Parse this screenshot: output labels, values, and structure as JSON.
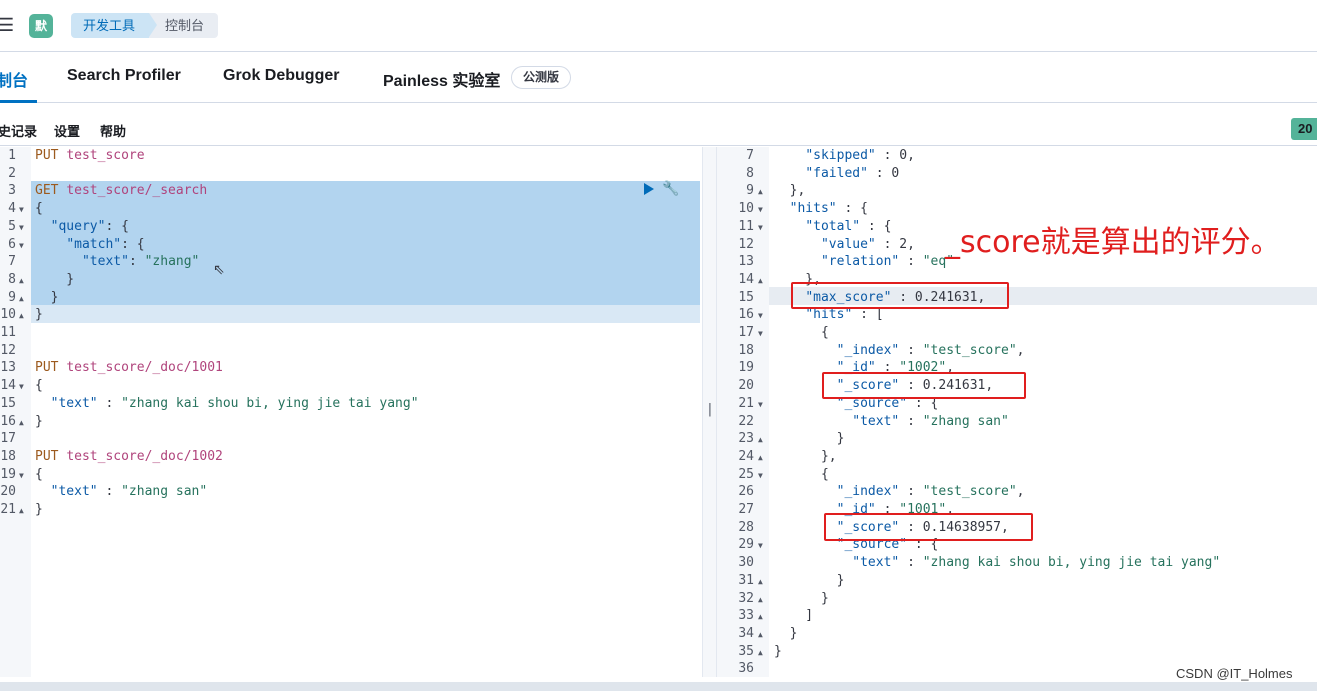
{
  "header": {
    "menu_icon": "hamburger-icon",
    "avatar_letter": "默",
    "breadcrumbs": [
      "开发工具",
      "控制台"
    ]
  },
  "tabs": {
    "console": "制台",
    "search_profiler": "Search Profiler",
    "grok_debugger": "Grok Debugger",
    "painless_lab": "Painless 实验室",
    "beta_badge": "公测版"
  },
  "toolbar": {
    "history": "史记录",
    "settings": "设置",
    "help": "帮助",
    "status_badge": "20"
  },
  "request_editor": {
    "lines": [
      {
        "n": "1",
        "fold": "",
        "text": "PUT test_score"
      },
      {
        "n": "2",
        "fold": "",
        "text": ""
      },
      {
        "n": "3",
        "fold": "",
        "text": "GET test_score/_search"
      },
      {
        "n": "4",
        "fold": "▼",
        "text": "{"
      },
      {
        "n": "5",
        "fold": "▼",
        "text": "  \"query\": {"
      },
      {
        "n": "6",
        "fold": "▼",
        "text": "    \"match\": {"
      },
      {
        "n": "7",
        "fold": "",
        "text": "      \"text\": \"zhang\""
      },
      {
        "n": "8",
        "fold": "▲",
        "text": "    }"
      },
      {
        "n": "9",
        "fold": "▲",
        "text": "  }"
      },
      {
        "n": "10",
        "fold": "▲",
        "text": "}"
      },
      {
        "n": "11",
        "fold": "",
        "text": ""
      },
      {
        "n": "12",
        "fold": "",
        "text": ""
      },
      {
        "n": "13",
        "fold": "",
        "text": "PUT test_score/_doc/1001"
      },
      {
        "n": "14",
        "fold": "▼",
        "text": "{"
      },
      {
        "n": "15",
        "fold": "",
        "text": "  \"text\" : \"zhang kai shou bi, ying jie tai yang\""
      },
      {
        "n": "16",
        "fold": "▲",
        "text": "}"
      },
      {
        "n": "17",
        "fold": "",
        "text": ""
      },
      {
        "n": "18",
        "fold": "",
        "text": "PUT test_score/_doc/1002"
      },
      {
        "n": "19",
        "fold": "▼",
        "text": "{"
      },
      {
        "n": "20",
        "fold": "",
        "text": "  \"text\" : \"zhang san\""
      },
      {
        "n": "21",
        "fold": "▲",
        "text": "}"
      }
    ]
  },
  "response_viewer": {
    "lines": [
      {
        "n": "7",
        "fold": "",
        "text": "    \"skipped\" : 0,"
      },
      {
        "n": "8",
        "fold": "",
        "text": "    \"failed\" : 0"
      },
      {
        "n": "9",
        "fold": "▲",
        "text": "  },"
      },
      {
        "n": "10",
        "fold": "▼",
        "text": "  \"hits\" : {"
      },
      {
        "n": "11",
        "fold": "▼",
        "text": "    \"total\" : {"
      },
      {
        "n": "12",
        "fold": "",
        "text": "      \"value\" : 2,"
      },
      {
        "n": "13",
        "fold": "",
        "text": "      \"relation\" : \"eq\""
      },
      {
        "n": "14",
        "fold": "▲",
        "text": "    },"
      },
      {
        "n": "15",
        "fold": "",
        "text": "    \"max_score\" : 0.241631,"
      },
      {
        "n": "16",
        "fold": "▼",
        "text": "    \"hits\" : ["
      },
      {
        "n": "17",
        "fold": "▼",
        "text": "      {"
      },
      {
        "n": "18",
        "fold": "",
        "text": "        \"_index\" : \"test_score\","
      },
      {
        "n": "19",
        "fold": "",
        "text": "        \"_id\" : \"1002\","
      },
      {
        "n": "20",
        "fold": "",
        "text": "        \"_score\" : 0.241631,"
      },
      {
        "n": "21",
        "fold": "▼",
        "text": "        \"_source\" : {"
      },
      {
        "n": "22",
        "fold": "",
        "text": "          \"text\" : \"zhang san\""
      },
      {
        "n": "23",
        "fold": "▲",
        "text": "        }"
      },
      {
        "n": "24",
        "fold": "▲",
        "text": "      },"
      },
      {
        "n": "25",
        "fold": "▼",
        "text": "      {"
      },
      {
        "n": "26",
        "fold": "",
        "text": "        \"_index\" : \"test_score\","
      },
      {
        "n": "27",
        "fold": "",
        "text": "        \"_id\" : \"1001\","
      },
      {
        "n": "28",
        "fold": "",
        "text": "        \"_score\" : 0.14638957,"
      },
      {
        "n": "29",
        "fold": "▼",
        "text": "        \"_source\" : {"
      },
      {
        "n": "30",
        "fold": "",
        "text": "          \"text\" : \"zhang kai shou bi, ying jie tai yang\""
      },
      {
        "n": "31",
        "fold": "▲",
        "text": "        }"
      },
      {
        "n": "32",
        "fold": "▲",
        "text": "      }"
      },
      {
        "n": "33",
        "fold": "▲",
        "text": "    ]"
      },
      {
        "n": "34",
        "fold": "▲",
        "text": "  }"
      },
      {
        "n": "35",
        "fold": "▲",
        "text": "}"
      },
      {
        "n": "36",
        "fold": "",
        "text": ""
      }
    ]
  },
  "annotation": "_score就是算出的评分。",
  "watermark": "CSDN @IT_Holmes",
  "divider_handle": "||",
  "colors": {
    "accent": "#0071c2",
    "highlight_box": "#e01e1e",
    "selection": "#b2d4ef"
  }
}
